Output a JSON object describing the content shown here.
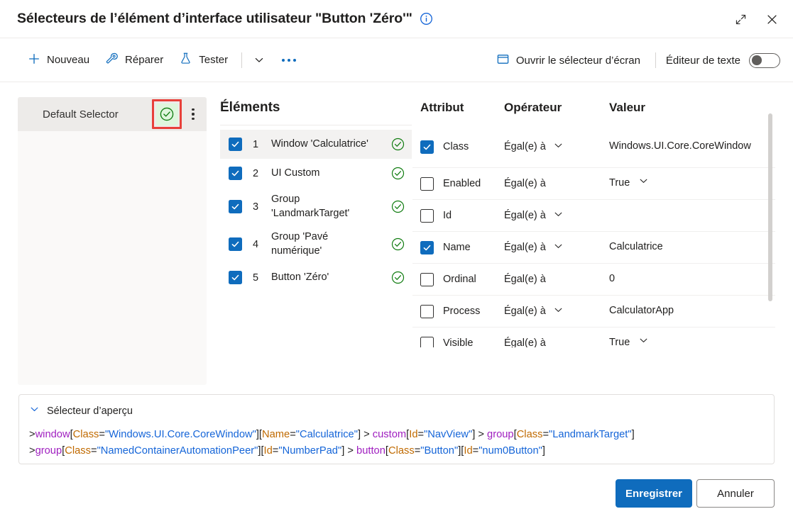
{
  "window": {
    "title": "Sélecteurs de l’élément d’interface utilisateur \"Button 'Zéro'\"",
    "info_icon": "info-icon",
    "expand_icon": "expand-icon",
    "close_icon": "close-icon"
  },
  "commandbar": {
    "new_label": "Nouveau",
    "repair_label": "Réparer",
    "test_label": "Tester",
    "overflow_label": "…",
    "screen_selector_label": "Ouvrir le sélecteur d’écran",
    "text_editor_label": "Éditeur de texte",
    "toggle_state": "off"
  },
  "selectors_panel": {
    "name": "Default Selector",
    "status_icon": "check-circle-icon",
    "more_icon": "more-vertical-icon",
    "highlight_color": "#e8403a"
  },
  "elements": {
    "title": "Éléments",
    "rows": [
      {
        "index": "1",
        "label": "Window 'Calculatrice'",
        "checked": true,
        "valid": true,
        "selected": true
      },
      {
        "index": "2",
        "label": "UI Custom",
        "checked": true,
        "valid": true,
        "selected": false
      },
      {
        "index": "3",
        "label": "Group 'LandmarkTarget'",
        "checked": true,
        "valid": true,
        "selected": false
      },
      {
        "index": "4",
        "label": "Group 'Pavé numérique'",
        "checked": true,
        "valid": true,
        "selected": false
      },
      {
        "index": "5",
        "label": "Button 'Zéro'",
        "checked": true,
        "valid": true,
        "selected": false
      }
    ]
  },
  "attributes": {
    "headers": {
      "attribute": "Attribut",
      "operator": "Opérateur",
      "value": "Valeur"
    },
    "rows": [
      {
        "name": "Class",
        "checked": true,
        "operator": "Égal(e) à",
        "op_chevron": true,
        "value": "Windows.UI.Core.CoreWindow",
        "val_chevron": false
      },
      {
        "name": "Enabled",
        "checked": false,
        "operator": "Égal(e) à",
        "op_chevron": false,
        "value": "True",
        "val_chevron": true
      },
      {
        "name": "Id",
        "checked": false,
        "operator": "Égal(e) à",
        "op_chevron": true,
        "value": "",
        "val_chevron": false
      },
      {
        "name": "Name",
        "checked": true,
        "operator": "Égal(e) à",
        "op_chevron": true,
        "value": "Calculatrice",
        "val_chevron": false
      },
      {
        "name": "Ordinal",
        "checked": false,
        "operator": "Égal(e) à",
        "op_chevron": false,
        "value": "0",
        "val_chevron": false
      },
      {
        "name": "Process",
        "checked": false,
        "operator": "Égal(e) à",
        "op_chevron": true,
        "value": "CalculatorApp",
        "val_chevron": false
      },
      {
        "name": "Visible",
        "checked": false,
        "operator": "Égal(e) à",
        "op_chevron": false,
        "value": "True",
        "val_chevron": true
      }
    ]
  },
  "preview": {
    "header_label": "Sélecteur d’aperçu",
    "chevron_icon": "chevron-down-icon",
    "lines": [
      [
        {
          "t": "gt",
          "s": ">"
        },
        {
          "t": "tag",
          "s": "window"
        },
        {
          "t": "brk",
          "s": "["
        },
        {
          "t": "attr",
          "s": "Class"
        },
        {
          "t": "eq",
          "s": "="
        },
        {
          "t": "val",
          "s": "\"Windows.UI.Core.CoreWindow\""
        },
        {
          "t": "brk",
          "s": "]"
        },
        {
          "t": "brk",
          "s": "["
        },
        {
          "t": "attr",
          "s": "Name"
        },
        {
          "t": "eq",
          "s": "="
        },
        {
          "t": "val",
          "s": "\"Calculatrice\""
        },
        {
          "t": "brk",
          "s": "]"
        },
        {
          "t": "gt",
          "s": " > "
        },
        {
          "t": "tag",
          "s": "custom"
        },
        {
          "t": "brk",
          "s": "["
        },
        {
          "t": "attr",
          "s": "Id"
        },
        {
          "t": "eq",
          "s": "="
        },
        {
          "t": "val",
          "s": "\"NavView\""
        },
        {
          "t": "brk",
          "s": "]"
        },
        {
          "t": "gt",
          "s": " > "
        },
        {
          "t": "tag",
          "s": "group"
        },
        {
          "t": "brk",
          "s": "["
        },
        {
          "t": "attr",
          "s": "Class"
        },
        {
          "t": "eq",
          "s": "="
        },
        {
          "t": "val",
          "s": "\"LandmarkTarget\""
        },
        {
          "t": "brk",
          "s": "]"
        }
      ],
      [
        {
          "t": "gt",
          "s": ">"
        },
        {
          "t": "tag",
          "s": "group"
        },
        {
          "t": "brk",
          "s": "["
        },
        {
          "t": "attr",
          "s": "Class"
        },
        {
          "t": "eq",
          "s": "="
        },
        {
          "t": "val",
          "s": "\"NamedContainerAutomationPeer\""
        },
        {
          "t": "brk",
          "s": "]"
        },
        {
          "t": "brk",
          "s": "["
        },
        {
          "t": "attr",
          "s": "Id"
        },
        {
          "t": "eq",
          "s": "="
        },
        {
          "t": "val",
          "s": "\"NumberPad\""
        },
        {
          "t": "brk",
          "s": "]"
        },
        {
          "t": "gt",
          "s": " > "
        },
        {
          "t": "tag",
          "s": "button"
        },
        {
          "t": "brk",
          "s": "["
        },
        {
          "t": "attr",
          "s": "Class"
        },
        {
          "t": "eq",
          "s": "="
        },
        {
          "t": "val",
          "s": "\"Button\""
        },
        {
          "t": "brk",
          "s": "]"
        },
        {
          "t": "brk",
          "s": "["
        },
        {
          "t": "attr",
          "s": "Id"
        },
        {
          "t": "eq",
          "s": "="
        },
        {
          "t": "val",
          "s": "\"num0Button\""
        },
        {
          "t": "brk",
          "s": "]"
        }
      ]
    ]
  },
  "footer": {
    "save_label": "Enregistrer",
    "cancel_label": "Annuler"
  },
  "colors": {
    "accent": "#0f6cbd",
    "success": "#107c10",
    "highlight": "#e8403a",
    "success_bg": "#dff6dd"
  }
}
